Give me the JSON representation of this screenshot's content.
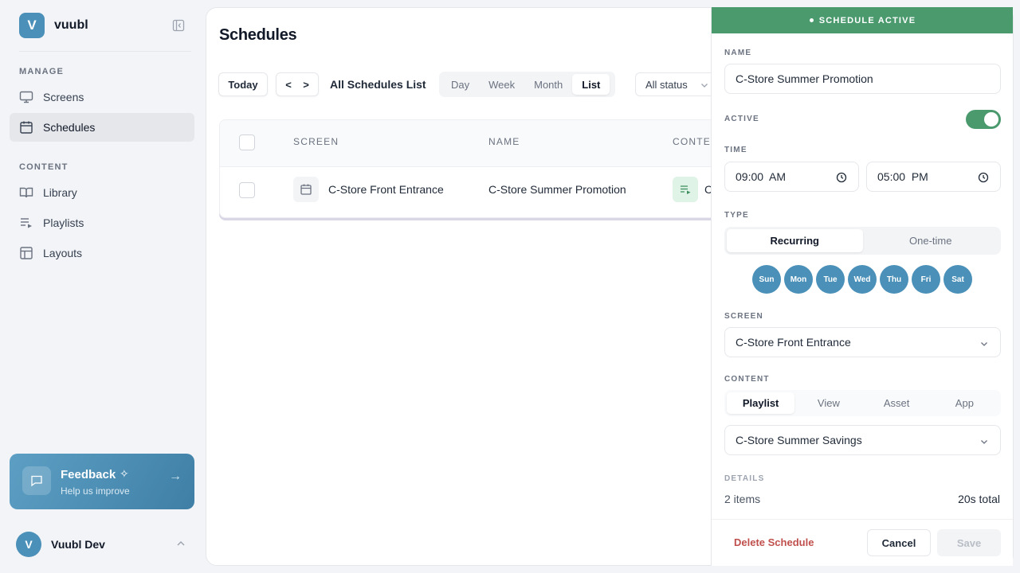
{
  "app": {
    "name": "vuubl",
    "logo_letter": "V"
  },
  "sidebar": {
    "sections": [
      {
        "label": "MANAGE",
        "items": [
          {
            "label": "Screens",
            "icon": "monitor-icon"
          },
          {
            "label": "Schedules",
            "icon": "calendar-icon",
            "active": true
          }
        ]
      },
      {
        "label": "CONTENT",
        "items": [
          {
            "label": "Library",
            "icon": "book-icon"
          },
          {
            "label": "Playlists",
            "icon": "playlist-icon"
          },
          {
            "label": "Layouts",
            "icon": "layout-icon"
          }
        ]
      }
    ],
    "feedback": {
      "title": "Feedback",
      "subtitle": "Help us improve"
    },
    "user": {
      "initial": "V",
      "name": "Vuubl Dev"
    }
  },
  "main": {
    "title": "Schedules",
    "toolbar": {
      "today": "Today",
      "prev": "<",
      "next": ">",
      "list_title": "All Schedules List",
      "views": [
        "Day",
        "Week",
        "Month",
        "List"
      ],
      "active_view": "List",
      "status_filter": "All status"
    },
    "table": {
      "headers": [
        "SCREEN",
        "NAME",
        "CONTE"
      ],
      "rows": [
        {
          "screen": "C-Store Front Entrance",
          "name": "C-Store Summer Promotion",
          "content": "C"
        }
      ]
    }
  },
  "panel": {
    "banner": "SCHEDULE ACTIVE",
    "name_label": "NAME",
    "name_value": "C-Store Summer Promotion",
    "active_label": "ACTIVE",
    "active": true,
    "time_label": "TIME",
    "time_start": "09:00  AM",
    "time_end": "05:00  PM",
    "type_label": "TYPE",
    "type_options": [
      "Recurring",
      "One-time"
    ],
    "type_selected": "Recurring",
    "days": [
      "Sun",
      "Mon",
      "Tue",
      "Wed",
      "Thu",
      "Fri",
      "Sat"
    ],
    "screen_label": "SCREEN",
    "screen_value": "C-Store Front Entrance",
    "content_label": "CONTENT",
    "content_tabs": [
      "Playlist",
      "View",
      "Asset",
      "App"
    ],
    "content_selected": "Playlist",
    "content_value": "C-Store Summer Savings",
    "details_label": "DETAILS",
    "details_items": "2 items",
    "details_total": "20s total",
    "delete_label": "Delete Schedule",
    "cancel_label": "Cancel",
    "save_label": "Save"
  },
  "colors": {
    "accent": "#4a90b8",
    "active_green": "#4a9a6e",
    "danger": "#c0504d"
  }
}
